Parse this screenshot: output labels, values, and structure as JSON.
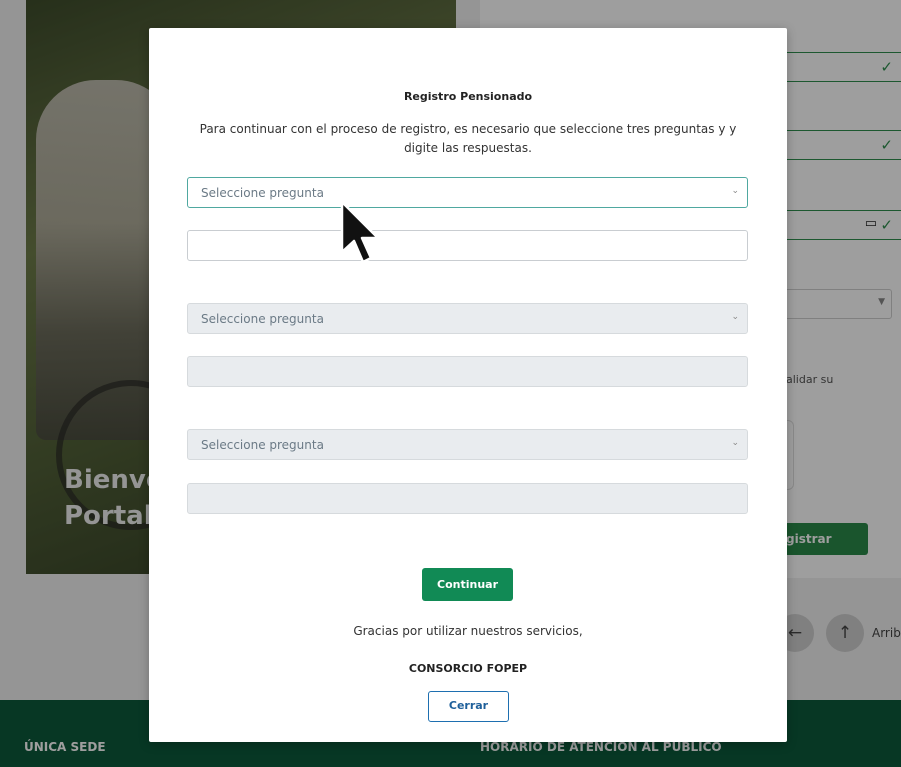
{
  "background": {
    "hero_title_line1": "Bienve",
    "hero_title_line2": "Portal",
    "validar_text": "alidar su",
    "registrar_label": "gistrar",
    "arriba_label": "Arrib",
    "footer_left": "ÚNICA SEDE",
    "footer_right": "HORARIO DE ATENCIÓN AL PÚBLICO",
    "nav_left_icon": "arrow-left-icon",
    "nav_up_icon": "arrow-up-icon"
  },
  "modal": {
    "title": "Registro Pensionado",
    "description": "Para continuar con el proceso de registro, es necesario que seleccione tres preguntas y y digite las respuestas.",
    "questions": [
      {
        "placeholder": "Seleccione pregunta",
        "answer": "",
        "state": "active"
      },
      {
        "placeholder": "Seleccione pregunta",
        "answer": "",
        "state": "disabled"
      },
      {
        "placeholder": "Seleccione pregunta",
        "answer": "",
        "state": "disabled"
      }
    ],
    "continue_label": "Continuar",
    "thanks": "Gracias por utilizar nuestros servicios,",
    "organization": "CONSORCIO FOPEP",
    "close_label": "Cerrar"
  },
  "colors": {
    "primary_green": "#118a55",
    "footer_green": "#0c5a3b",
    "close_blue": "#1e6fb0"
  }
}
